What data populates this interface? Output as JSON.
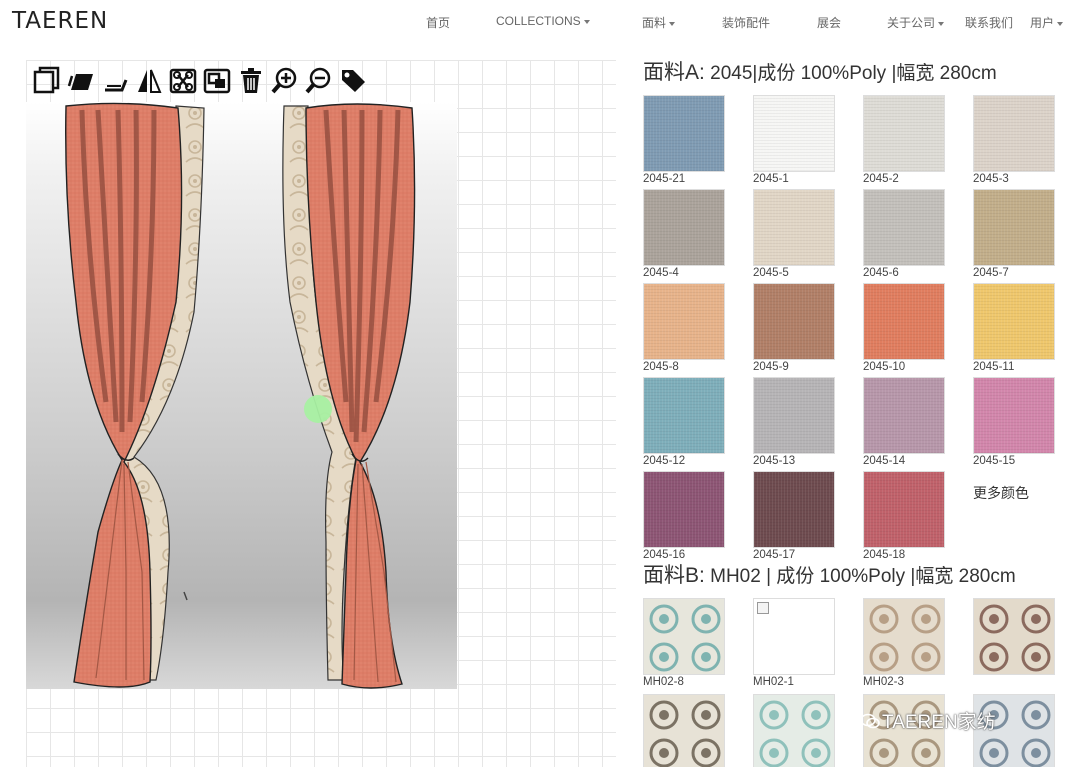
{
  "brand": "TAEREN",
  "nav": [
    {
      "label": "首页",
      "caret": false
    },
    {
      "label": "COLLECTIONS",
      "caret": true
    },
    {
      "label": "面料",
      "caret": true
    },
    {
      "label": "装饰配件",
      "caret": false
    },
    {
      "label": "展会",
      "caret": false
    },
    {
      "label": "关于公司",
      "caret": true
    },
    {
      "label": "联系我们",
      "caret": false
    },
    {
      "label": "用户",
      "caret": true
    }
  ],
  "toolbar": [
    "layer-front-icon",
    "layer-back-icon",
    "send-backward-icon",
    "flip-icon",
    "group-icon",
    "ungroup-icon",
    "trash-icon",
    "zoom-in-icon",
    "zoom-out-icon",
    "tag-icon"
  ],
  "fabricA": {
    "title_prefix": "面料A:",
    "title_rest": " 2045|成份 100%Poly |幅宽 280cm",
    "swatches": [
      {
        "code": "2045-21",
        "color": "#7f9bb3"
      },
      {
        "code": "2045-1",
        "color": "#f6f6f4"
      },
      {
        "code": "2045-2",
        "color": "#dedcd6"
      },
      {
        "code": "2045-3",
        "color": "#dcd3c9"
      },
      {
        "code": "2045-4",
        "color": "#aba39b"
      },
      {
        "code": "2045-5",
        "color": "#e1d6c6"
      },
      {
        "code": "2045-6",
        "color": "#c3c0bb"
      },
      {
        "code": "2045-7",
        "color": "#c2ae8a"
      },
      {
        "code": "2045-8",
        "color": "#e7b38a"
      },
      {
        "code": "2045-9",
        "color": "#b17f67"
      },
      {
        "code": "2045-10",
        "color": "#e07d5f"
      },
      {
        "code": "2045-11",
        "color": "#efc76c"
      },
      {
        "code": "2045-12",
        "color": "#7eaeba"
      },
      {
        "code": "2045-13",
        "color": "#b6b4b6"
      },
      {
        "code": "2045-14",
        "color": "#b797aa"
      },
      {
        "code": "2045-15",
        "color": "#d286ab"
      },
      {
        "code": "2045-16",
        "color": "#8d5574"
      },
      {
        "code": "2045-17",
        "color": "#6e4b4f"
      },
      {
        "code": "2045-18",
        "color": "#c0616a"
      }
    ],
    "more_label": "更多颜色"
  },
  "fabricB": {
    "title_prefix": "面料B:",
    "title_rest": " MH02 | 成份 100%Poly |幅宽 280cm",
    "swatches": [
      {
        "code": "MH02-8",
        "color": "#e7e6dc",
        "ink": "#7fb3b0"
      },
      {
        "code": "MH02-1",
        "color": "#ffffff",
        "broken": true
      },
      {
        "code": "MH02-3",
        "color": "#e5dccd",
        "ink": "#b79f86"
      },
      {
        "code": "",
        "color": "#e3dacb",
        "ink": "#8b6a5e"
      },
      {
        "code": "",
        "color": "#e7e2d6",
        "ink": "#7b7264"
      },
      {
        "code": "",
        "color": "#e5ece6",
        "ink": "#8fc1bb"
      },
      {
        "code": "",
        "color": "#e8e2d3",
        "ink": "#a9977f"
      },
      {
        "code": "",
        "color": "#dfe3e6",
        "ink": "#7d8f9f"
      }
    ]
  },
  "watermark": "TAEREN家纺",
  "colors": {
    "curtain": "#de7d67",
    "curtain_dark": "#8c4a3b",
    "lining": "#e3d6c1",
    "handle": "#a8f0a2"
  }
}
